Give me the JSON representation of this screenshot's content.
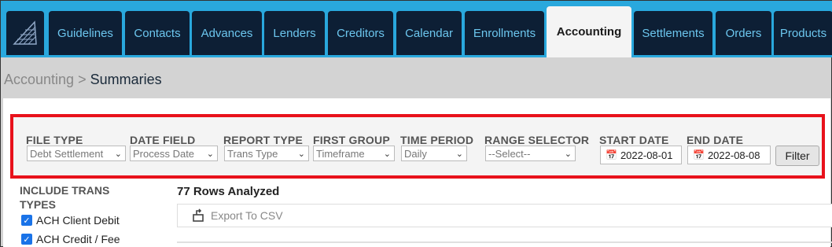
{
  "nav": {
    "tabs": [
      {
        "label": "Guidelines"
      },
      {
        "label": "Contacts"
      },
      {
        "label": "Advances"
      },
      {
        "label": "Lenders"
      },
      {
        "label": "Creditors"
      },
      {
        "label": "Calendar"
      },
      {
        "label": "Enrollments"
      },
      {
        "label": "Accounting"
      },
      {
        "label": "Settlements"
      },
      {
        "label": "Orders"
      },
      {
        "label": "Products"
      }
    ],
    "active": "Accounting"
  },
  "breadcrumb": {
    "parent": "Accounting",
    "separator": ">",
    "current": "Summaries"
  },
  "filters": {
    "file_type": {
      "label": "FILE TYPE",
      "value": "Debt Settlement"
    },
    "date_field": {
      "label": "DATE FIELD",
      "value": "Process Date"
    },
    "report_type": {
      "label": "REPORT TYPE",
      "value": "Trans Type"
    },
    "first_group": {
      "label": "FIRST GROUP",
      "value": "Timeframe"
    },
    "time_period": {
      "label": "TIME PERIOD",
      "value": "Daily"
    },
    "range_selector": {
      "label": "RANGE SELECTOR",
      "value": "--Select--"
    },
    "start_date": {
      "label": "START DATE",
      "value": "2022-08-01"
    },
    "end_date": {
      "label": "END DATE",
      "value": "2022-08-08"
    },
    "filter_button": "Filter"
  },
  "sidebar": {
    "title": "INCLUDE TRANS TYPES",
    "items": [
      {
        "label": "ACH Client Debit",
        "checked": true
      },
      {
        "label": "ACH Credit / Fee",
        "checked": true
      }
    ]
  },
  "results": {
    "rows_analyzed": "77 Rows Analyzed",
    "export_label": "Export To CSV"
  },
  "colors": {
    "topbar": "#29a8dd",
    "tab_bg": "#0d1f35",
    "tab_text": "#6cc6ee",
    "highlight_border": "#e8121b"
  }
}
